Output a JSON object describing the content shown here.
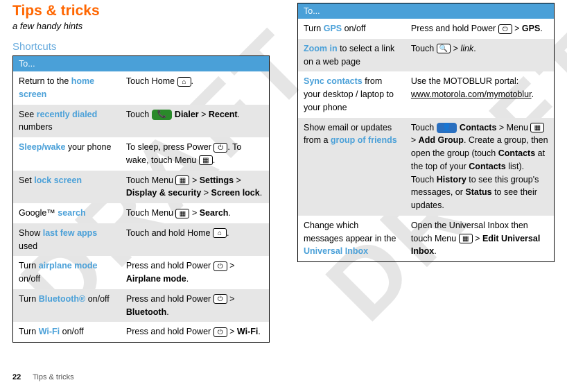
{
  "watermark": "DRAFT",
  "page": {
    "title": "Tips & tricks",
    "subtitle": "a few handy hints",
    "section": "Shortcuts",
    "footer_page": "22",
    "footer_label": "Tips & tricks"
  },
  "icons": {
    "home": "⌂",
    "dialer": "📞",
    "power": "⏻",
    "menu": "▦",
    "search": "🔍",
    "contacts": "👤"
  },
  "table1": {
    "header": "To...",
    "rows": [
      {
        "left_pre": "Return to the ",
        "left_hl": "home screen",
        "left_post": "",
        "right_pre": "Touch Home ",
        "right_icon": "home",
        "right_post": "."
      },
      {
        "left_pre": "See ",
        "left_hl": "recently dialed",
        "left_post": " numbers",
        "right_pre": "Touch ",
        "right_pillicon": "dialer",
        "right_bold1": " Dialer",
        "right_mid": " > ",
        "right_bold2": "Recent",
        "right_post": "."
      },
      {
        "left_hl": "Sleep/wake",
        "left_post": " your phone",
        "right_pre": "To sleep, press Power ",
        "right_icon": "power",
        "right_mid": ". To wake, touch Menu ",
        "right_icon2": "menu",
        "right_post": "."
      },
      {
        "left_pre": "Set ",
        "left_hl": "lock screen",
        "right_pre": "Touch Menu ",
        "right_icon": "menu",
        "right_mid": " > ",
        "right_bold1": "Settings",
        "right_mid2": " > ",
        "right_bold2": "Display & security",
        "right_mid3": " > ",
        "right_bold3": "Screen lock",
        "right_post": "."
      },
      {
        "left_pre": "Google™ ",
        "left_hl": "search",
        "right_pre": "Touch Menu ",
        "right_icon": "menu",
        "right_mid": " > ",
        "right_bold1": "Search",
        "right_post": "."
      },
      {
        "left_pre": "Show ",
        "left_hl": "last few apps",
        "left_post": " used",
        "right_pre": "Touch and hold Home ",
        "right_icon": "home",
        "right_post": "."
      },
      {
        "left_pre": "Turn ",
        "left_hl": "airplane mode",
        "left_post": " on/off",
        "right_pre": "Press and hold Power ",
        "right_icon": "power",
        "right_mid": " > ",
        "right_bold1": "Airplane mode",
        "right_post": "."
      },
      {
        "left_pre": "Turn ",
        "left_hl": "Bluetooth®",
        "left_post": " on/off",
        "right_pre": "Press and hold Power ",
        "right_icon": "power",
        "right_mid": " > ",
        "right_bold1": "Bluetooth",
        "right_post": "."
      },
      {
        "left_pre": "Turn ",
        "left_hl": "Wi-Fi",
        "left_post": " on/off",
        "right_pre": "Press and hold Power ",
        "right_icon": "power",
        "right_mid": " > ",
        "right_bold1": "Wi-Fi",
        "right_post": "."
      }
    ]
  },
  "table2": {
    "header": "To...",
    "rows": [
      {
        "left_pre": "Turn ",
        "left_hl": "GPS",
        "left_post": " on/off",
        "right_pre": "Press and hold Power ",
        "right_icon": "power",
        "right_mid": " > ",
        "right_bold1": "GPS",
        "right_post": "."
      },
      {
        "left_hl": "Zoom in",
        "left_post": " to select a link on a web page",
        "right_pre": "Touch ",
        "right_icon": "search",
        "right_mid": " > ",
        "right_italic": "link",
        "right_post": "."
      },
      {
        "left_hl": "Sync contacts",
        "left_post": " from your desktop / laptop to your phone",
        "right_pre": "Use the MOTOBLUR portal: ",
        "right_link": "www.motorola.com/mymotoblur",
        "right_post": "."
      },
      {
        "left_pre": "Show email or updates from a ",
        "left_hl": "group of friends",
        "right_pre": "Touch ",
        "right_pillicon_blue": "contacts",
        "right_bold1": " Contacts",
        "right_mid": " > Menu ",
        "right_icon2": "menu",
        "right_mid2": " > ",
        "right_bold2": "Add Group",
        "right_text2": ". Create a group, then open the group (touch ",
        "right_bold3": "Contacts",
        "right_text3": " at the top of your ",
        "right_bold4": "Contacts",
        "right_text4": " list). Touch ",
        "right_bold5": "History",
        "right_text5": " to see this group's messages, or ",
        "right_bold6": "Status",
        "right_text6": " to see their updates."
      },
      {
        "left_pre": "Change which messages appear in the ",
        "left_hl": "Universal Inbox",
        "right_pre": "Open the Universal Inbox then touch Menu ",
        "right_icon": "menu",
        "right_mid": " > ",
        "right_bold1": "Edit Universal Inbox",
        "right_post": "."
      }
    ]
  }
}
